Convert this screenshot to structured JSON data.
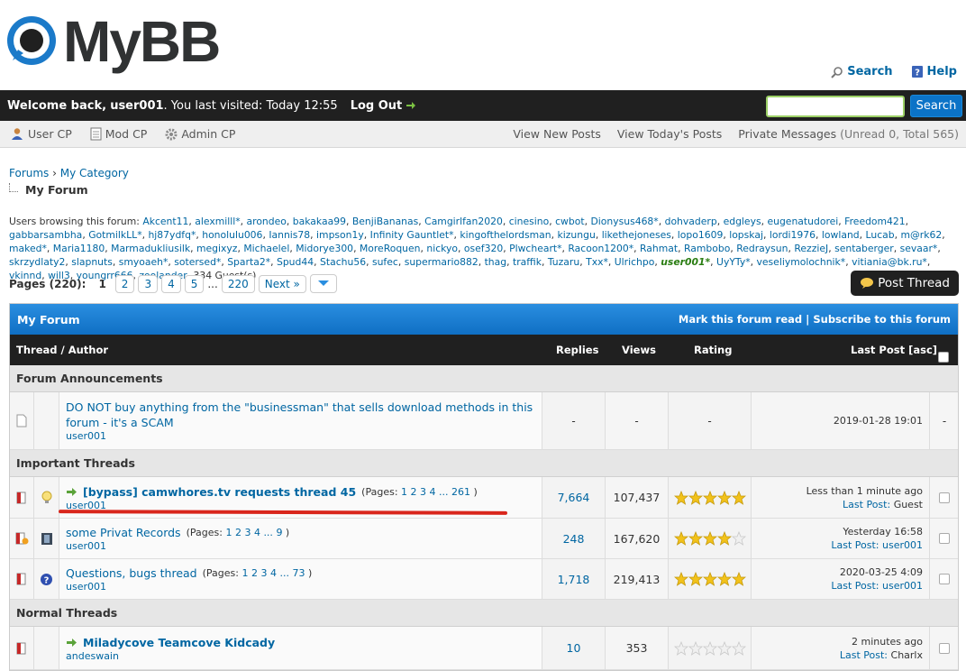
{
  "header": {
    "logo_text": "MyBB",
    "search_link": "Search",
    "help_link": "Help"
  },
  "welcome": {
    "prefix": "Welcome back,",
    "username": "user001",
    "visited": ". You last visited: Today 12:55",
    "logout": "Log Out",
    "search_button": "Search",
    "search_value": ""
  },
  "panel": {
    "user_cp": "User CP",
    "mod_cp": "Mod CP",
    "admin_cp": "Admin CP",
    "view_new": "View New Posts",
    "view_today": "View Today's Posts",
    "pm_label": "Private Messages",
    "pm_counts": "(Unread 0, Total 565)"
  },
  "breadcrumb": {
    "forums": "Forums",
    "sep": "›",
    "category": "My Category",
    "current": "My Forum"
  },
  "browsing": {
    "label": "Users browsing this forum:",
    "line1": [
      "Akcent11",
      "alexmilll*",
      "arondeo",
      "bakakaa99",
      "BenjiBananas",
      "Camgirlfan2020",
      "cinesino",
      "cwbot",
      "Dionysus468*",
      "dohvaderp",
      "edgleys",
      "eugenatudorei",
      "Freedom421",
      "gabbarsambha",
      "GotmilkLL*"
    ],
    "line2": [
      "hj87ydfq*",
      "honolulu006",
      "Iannis78",
      "impson1y",
      "Infinity Gauntlet*",
      "kingofthelordsman",
      "kizungu",
      "likethejoneses",
      "lopo1609",
      "lopskaj",
      "lordi1976",
      "lowland",
      "Lucab",
      "m@rk62",
      "maked*",
      "Maria1180",
      "Marmadukliusilk",
      "megixyz"
    ],
    "line3": [
      "Michaelel",
      "Midorye300",
      "MoreRoquen",
      "nickyo",
      "osef320",
      "Plwcheart*",
      "Racoon1200*",
      "Rahmat",
      "Rambobo",
      "Redraysun",
      "RezzieJ",
      "sentaberger",
      "sevaar*",
      "skrzydlaty2",
      "slapnuts",
      "smyoaeh*",
      "sotersed*",
      "Sparta2*",
      "Spud44"
    ],
    "line4a": [
      "Stachu56",
      "sufec",
      "supermario882",
      "thag",
      "traffik",
      "Tuzaru",
      "Txx*",
      "Ulrichpo"
    ],
    "me": "user001*",
    "line4b": [
      "UyYTy*",
      "veseliymolochnik*",
      "vitiania@bk.ru*",
      "vkinnd",
      "will3",
      "youngrr666",
      "zoolander"
    ],
    "guests": "334 Guest(s)"
  },
  "pagination": {
    "label": "Pages (220):",
    "current": "1",
    "pages": [
      "2",
      "3",
      "4",
      "5"
    ],
    "ellipsis": "...",
    "last": "220",
    "next": "Next »"
  },
  "post_thread": "Post Thread",
  "forum": {
    "title": "My Forum",
    "mark_read": "Mark this forum read",
    "op_sep": "|",
    "subscribe": "Subscribe to this forum",
    "headers": {
      "thread_author": "Thread / Author",
      "replies": "Replies",
      "views": "Views",
      "rating": "Rating",
      "last_post": "Last Post [asc]"
    },
    "sections": {
      "announcements": "Forum Announcements",
      "important": "Important Threads",
      "normal": "Normal Threads"
    },
    "announcement": {
      "title": "DO NOT buy anything from the \"businessman\" that sells download methods in this forum - it's a SCAM",
      "author": "user001",
      "replies": "-",
      "views": "-",
      "rating": "-",
      "last_post": "2019-01-28 19:01",
      "mod": "-"
    },
    "threads": [
      {
        "title": "[bypass] camwhores.tv requests thread 45",
        "bold": true,
        "pages_label": "(Pages:",
        "pages": [
          "1",
          "2",
          "3",
          "4"
        ],
        "ellipsis": "...",
        "last_page": "261",
        "close": ")",
        "author": "user001",
        "replies": "7,664",
        "views": "107,437",
        "rating": 5,
        "last_time": "Less than 1 minute ago",
        "last_label": "Last Post:",
        "last_user": "Guest",
        "user_link": false
      },
      {
        "title": "some Privat Records",
        "bold": false,
        "pages_label": "(Pages:",
        "pages": [
          "1",
          "2",
          "3",
          "4"
        ],
        "ellipsis": "...",
        "last_page": "9",
        "close": ")",
        "author": "user001",
        "replies": "248",
        "views": "167,620",
        "rating": 4,
        "last_time": "Yesterday 16:58",
        "last_label": "Last Post:",
        "last_user": "user001",
        "user_link": true
      },
      {
        "title": "Questions, bugs thread",
        "bold": false,
        "pages_label": "(Pages:",
        "pages": [
          "1",
          "2",
          "3",
          "4"
        ],
        "ellipsis": "...",
        "last_page": "73",
        "close": ")",
        "author": "user001",
        "replies": "1,718",
        "views": "219,413",
        "rating": 5,
        "last_time": "2020-03-25 4:09",
        "last_label": "Last Post:",
        "last_user": "user001",
        "user_link": true
      }
    ],
    "normal_thread": {
      "title": "Miladycove Teamcove Kidcady",
      "author": "andeswain",
      "replies": "10",
      "views": "353",
      "rating": 0,
      "last_time": "2 minutes ago",
      "last_label": "Last Post:",
      "last_user": "Charlx"
    }
  },
  "colors": {
    "accent": "#0b73c7",
    "dark_bar": "#202020",
    "link": "#0066a2",
    "star": "#f2c21a",
    "annotation": "#d9261c"
  }
}
